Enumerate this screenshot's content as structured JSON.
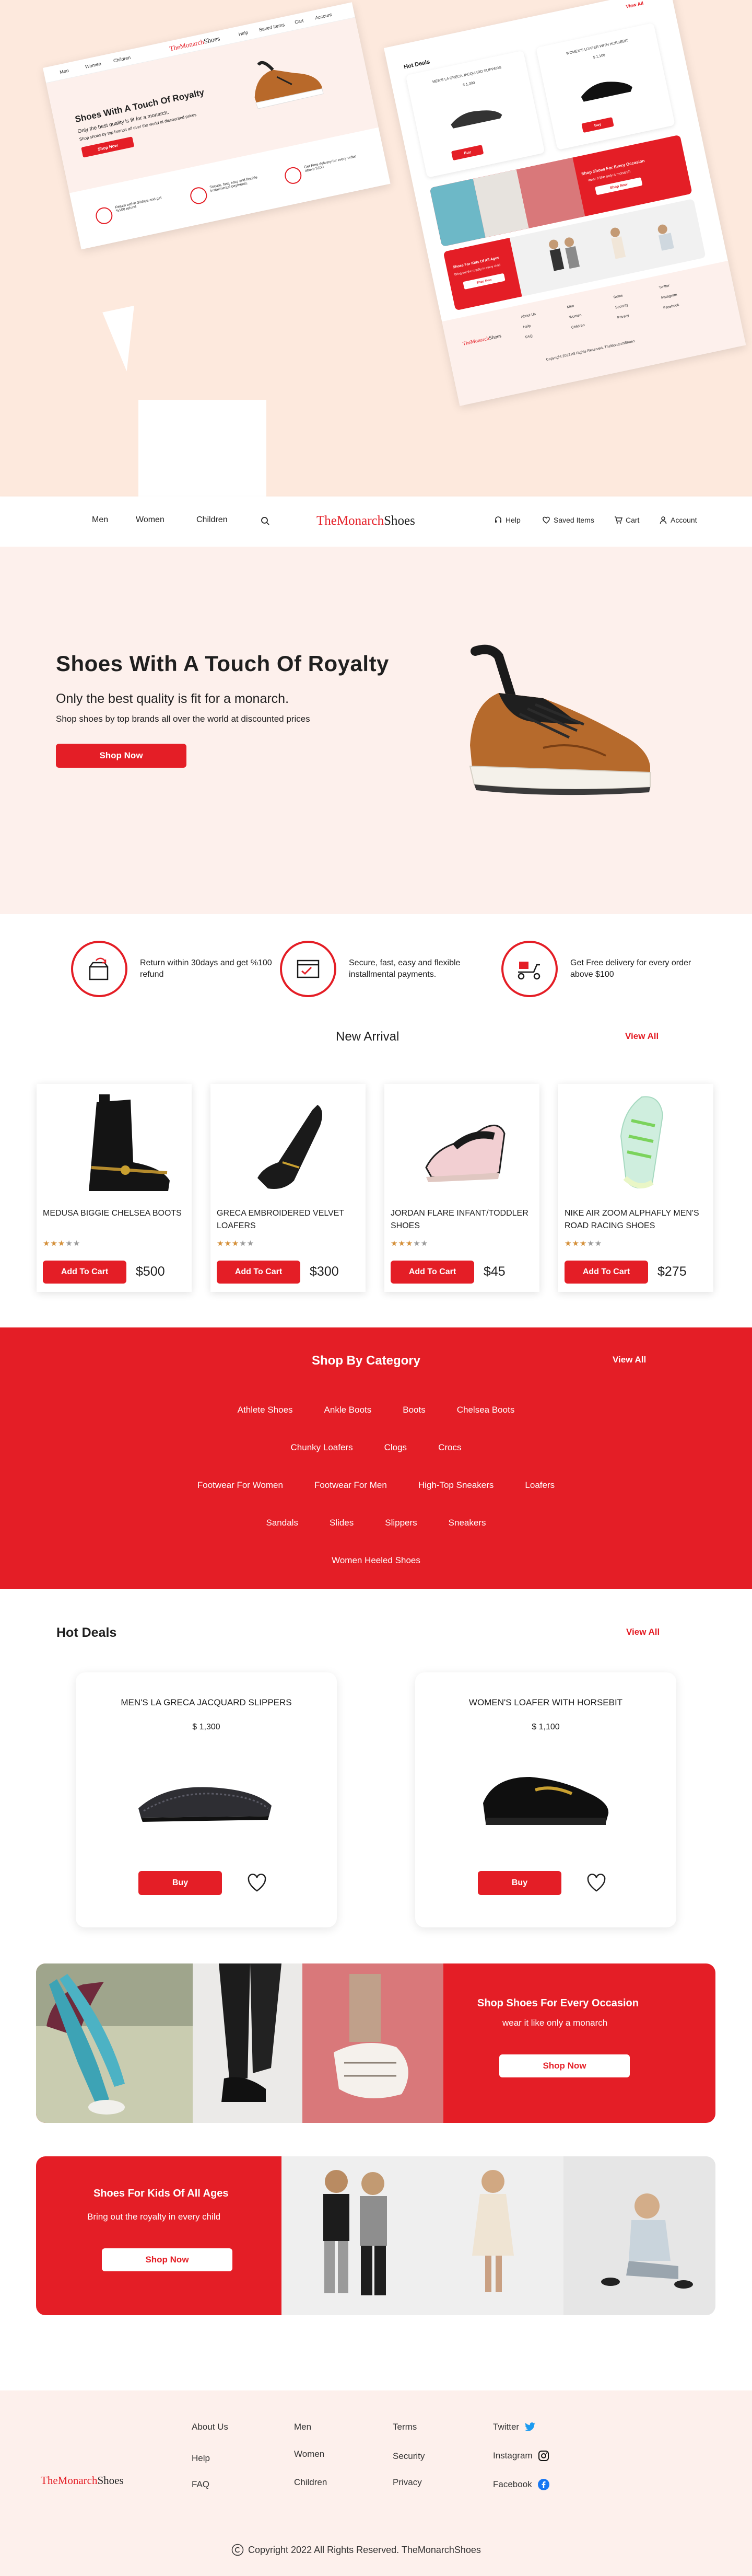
{
  "brand": {
    "part1": "TheMonarch",
    "part2": "Shoes"
  },
  "mockup": {
    "left_nav": [
      "Men",
      "Women",
      "Children"
    ],
    "left_right_nav": [
      "Help",
      "Saved Items",
      "Cart",
      "Account"
    ],
    "left_title": "Shoes With A Touch Of Royalty",
    "left_sub": "Only the best quality is fit for a monarch.",
    "left_desc": "Shop shoes by top brands all over the world at discounted prices",
    "left_btn": "Shop Now",
    "features": [
      "Return within 30days and get %100 refund",
      "Secure, fast, easy and flexible installmental payments.",
      "Get Free delivery for every order above $100"
    ],
    "right_view_all": "View All",
    "right_hot": "Hot Deals",
    "right_card1": "MEN'S LA GRECA JACQUARD SLIPPERS",
    "right_card1_price": "$ 1,300",
    "right_card2": "WOMEN'S LOAFER WITH HORSEBIT",
    "right_card2_price": "$ 1,100",
    "right_buy": "Buy",
    "right_occ": "Shop Shoes For Every Occasion",
    "right_occ_sub": "wear it like only a monarch",
    "right_kids": "Shoes For Kids Of All Ages",
    "right_kids_sub": "Bring out the royalty in every child",
    "right_shop": "Shop Now",
    "right_footer": [
      "About Us",
      "Help",
      "FAQ",
      "Men",
      "Women",
      "Children",
      "Terms",
      "Security",
      "Privacy",
      "Twitter",
      "Instagram",
      "Facebook"
    ],
    "right_copyright": "Copyright 2022 All Rights Reserved. TheMonarchShoes"
  },
  "header": {
    "nav": [
      "Men",
      "Women",
      "Children"
    ],
    "help": "Help",
    "saved": "Saved Items",
    "cart": "Cart",
    "account": "Account"
  },
  "hero": {
    "title": "Shoes  With  A Touch Of Royalty",
    "subtitle": "Only the best quality is fit for a monarch.",
    "desc": "Shop shoes by top brands all over the world at discounted prices",
    "button": "Shop Now"
  },
  "features": [
    {
      "text": "Return within 30days and get %100 refund",
      "icon": "refund-box-icon"
    },
    {
      "text": "Secure, fast, easy and flexible installmental payments.",
      "icon": "payment-form-icon"
    },
    {
      "text": "Get Free delivery for every order  above $100",
      "icon": "delivery-scooter-icon"
    }
  ],
  "new_arrival": {
    "title": "New Arrival",
    "view_all": "View All",
    "add_label": "Add To Cart",
    "products": [
      {
        "name": "MEDUSA BIGGIE CHELSEA BOOTS",
        "price": "$500",
        "rating": 3
      },
      {
        "name": "GRECA EMBROIDERED VELVET LOAFERS",
        "price": "$300",
        "rating": 3
      },
      {
        "name": "JORDAN FLARE INFANT/TODDLER SHOES",
        "price": "$45",
        "rating": 3
      },
      {
        "name": "NIKE AIR ZOOM ALPHAFLY MEN'S ROAD RACING SHOES",
        "price": "$275",
        "rating": 3
      }
    ]
  },
  "category": {
    "title": "Shop By Category",
    "view_all": "View All",
    "rows": [
      [
        "Athlete Shoes",
        "Ankle Boots",
        "Boots",
        "Chelsea Boots"
      ],
      [
        "Chunky Loafers",
        "Clogs",
        "Crocs"
      ],
      [
        "Footwear For Women",
        "Footwear For Men",
        "High-Top Sneakers",
        "Loafers"
      ],
      [
        "Sandals",
        "Slides",
        "Slippers",
        "Sneakers"
      ],
      [
        "Women Heeled Shoes"
      ]
    ]
  },
  "hot_deals": {
    "title": "Hot  Deals",
    "view_all": "View All",
    "buy": "Buy",
    "items": [
      {
        "name": "MEN'S LA GRECA JACQUARD SLIPPERS",
        "price": "$ 1,300"
      },
      {
        "name": "WOMEN'S LOAFER WITH HORSEBIT",
        "price": "$ 1,100"
      }
    ]
  },
  "occasion": {
    "title": "Shop Shoes For Every Occasion",
    "sub": "wear it like only a monarch",
    "button": "Shop Now"
  },
  "kids": {
    "title": "Shoes For Kids Of All Ages",
    "sub": "Bring out the royalty in every child",
    "button": "Shop Now"
  },
  "footer": {
    "col1": [
      "About Us",
      "Help",
      "FAQ"
    ],
    "col2": [
      "Men",
      "Women",
      "Children"
    ],
    "col3": [
      "Terms",
      "Security",
      "Privacy"
    ],
    "social": [
      "Twitter",
      "Instagram",
      "Facebook"
    ],
    "copyright": "Copyright 2022  All  Rights Reserved. TheMonarchShoes"
  },
  "colors": {
    "accent": "#e41e26",
    "hero_bg": "#fdf0ec",
    "mockup_bg": "#fde9dd"
  }
}
